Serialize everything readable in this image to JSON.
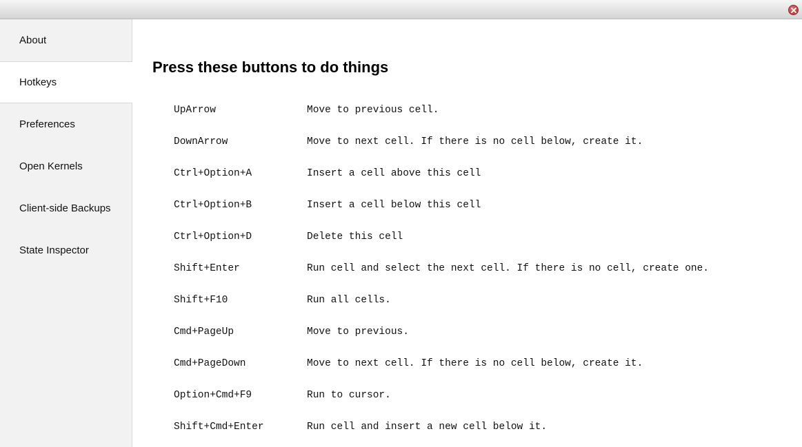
{
  "window": {
    "close_icon": "close-icon",
    "close_color": "#b03a3a"
  },
  "sidebar": {
    "items": [
      {
        "label": "About",
        "active": false
      },
      {
        "label": "Hotkeys",
        "active": true
      },
      {
        "label": "Preferences",
        "active": false
      },
      {
        "label": "Open Kernels",
        "active": false
      },
      {
        "label": "Client-side Backups",
        "active": false
      },
      {
        "label": "State Inspector",
        "active": false
      }
    ]
  },
  "main": {
    "title": "Press these buttons to do things",
    "hotkeys": [
      {
        "key": "UpArrow",
        "description": "Move to previous cell."
      },
      {
        "key": "DownArrow",
        "description": "Move to next cell. If there is no cell below, create it."
      },
      {
        "key": "Ctrl+Option+A",
        "description": "Insert a cell above this cell"
      },
      {
        "key": "Ctrl+Option+B",
        "description": "Insert a cell below this cell"
      },
      {
        "key": "Ctrl+Option+D",
        "description": "Delete this cell"
      },
      {
        "key": "Shift+Enter",
        "description": "Run cell and select the next cell. If there is no cell, create one."
      },
      {
        "key": "Shift+F10",
        "description": "Run all cells."
      },
      {
        "key": "Cmd+PageUp",
        "description": "Move to previous."
      },
      {
        "key": "Cmd+PageDown",
        "description": "Move to next cell. If there is no cell below, create it."
      },
      {
        "key": "Option+Cmd+F9",
        "description": "Run to cursor."
      },
      {
        "key": "Shift+Cmd+Enter",
        "description": "Run cell and insert a new cell below it."
      }
    ]
  }
}
